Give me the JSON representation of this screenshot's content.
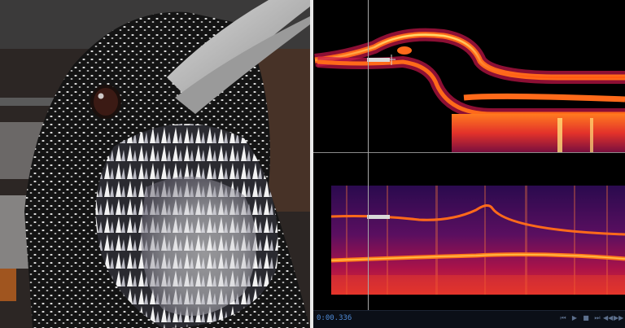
{
  "photo": {
    "subject_icon": "bird-photo",
    "palette": {
      "feather_dark": "#141414",
      "feather_light": "#e8e8e8",
      "beak": "#b9b9b9",
      "background": "#2a2220"
    }
  },
  "spectrogram": {
    "palette": {
      "hot": "#ffd05a",
      "warm": "#ff6a1a",
      "mid": "#c4164a",
      "cool": "#3a0a5e",
      "bg": "#000000"
    }
  },
  "footer": {
    "timecode": "0:00.336",
    "controls": [
      {
        "name": "skip-back-icon",
        "glyph": "⏮"
      },
      {
        "name": "play-icon",
        "glyph": "▶"
      },
      {
        "name": "stop-icon",
        "glyph": "■"
      },
      {
        "name": "skip-forward-icon",
        "glyph": "⏭"
      },
      {
        "name": "rewind-icon",
        "glyph": "◀◀"
      },
      {
        "name": "fast-forward-icon",
        "glyph": "▶▶"
      }
    ]
  }
}
